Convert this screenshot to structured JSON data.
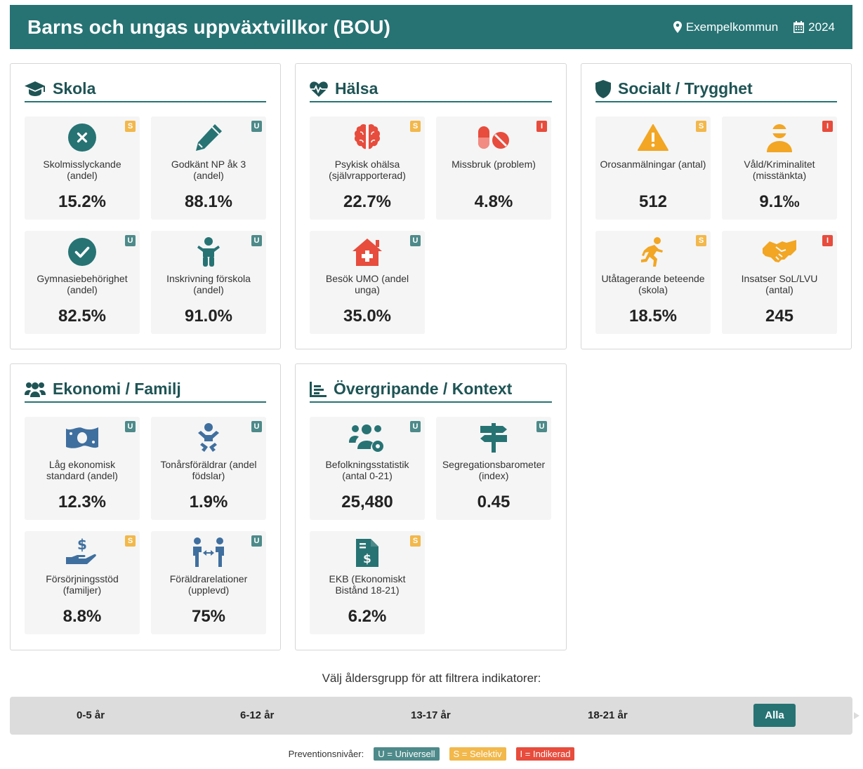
{
  "header": {
    "title": "Barns och ungas uppväxtvillkor (BOU)",
    "location": "Exempelkommun",
    "year": "2024"
  },
  "colors": {
    "primary": "#277374",
    "universell": "#4e8a8a",
    "selektiv": "#f2b84b",
    "indikerad": "#e74c3c",
    "icon_teal": "#277374",
    "icon_red": "#e74c3c",
    "icon_orange": "#f2a623",
    "icon_blue": "#3f6f9f"
  },
  "sections": {
    "skola": {
      "title": "Skola",
      "icon": "graduation-cap-icon",
      "tiles": [
        {
          "label": "Skolmisslyckande (andel)",
          "value": "15.2%",
          "level": "S",
          "icon": "x-circle-icon"
        },
        {
          "label": "Godkänt NP åk 3 (andel)",
          "value": "88.1%",
          "level": "U",
          "icon": "pencil-icon"
        },
        {
          "label": "Gymnasiebehörighet (andel)",
          "value": "82.5%",
          "level": "U",
          "icon": "check-circle-icon"
        },
        {
          "label": "Inskrivning förskola (andel)",
          "value": "91.0%",
          "level": "U",
          "icon": "child-icon"
        }
      ]
    },
    "halsa": {
      "title": "Hälsa",
      "icon": "heartbeat-icon",
      "tiles": [
        {
          "label": "Psykisk ohälsa (självrapporterad)",
          "value": "22.7%",
          "level": "S",
          "icon": "brain-icon"
        },
        {
          "label": "Missbruk (problem)",
          "value": "4.8%",
          "level": "I",
          "icon": "pills-icon"
        },
        {
          "label": "Besök UMO (andel unga)",
          "value": "35.0%",
          "level": "U",
          "icon": "clinic-house-icon"
        }
      ]
    },
    "socialt": {
      "title": "Socialt / Trygghet",
      "icon": "shield-icon",
      "tiles": [
        {
          "label": "Orosanmälningar (antal)",
          "value": "512",
          "level": "S",
          "icon": "warning-icon"
        },
        {
          "label": "Våld/Kriminalitet (misstänkta)",
          "value": "9.1‰",
          "level": "I",
          "icon": "masked-person-icon"
        },
        {
          "label": "Utåtagerande beteende (skola)",
          "value": "18.5%",
          "level": "S",
          "icon": "running-person-icon"
        },
        {
          "label": "Insatser SoL/LVU (antal)",
          "value": "245",
          "level": "I",
          "icon": "handshake-icon"
        }
      ]
    },
    "ekonomi": {
      "title": "Ekonomi / Familj",
      "icon": "users-icon",
      "tiles": [
        {
          "label": "Låg ekonomisk standard (andel)",
          "value": "12.3%",
          "level": "U",
          "icon": "money-bill-icon"
        },
        {
          "label": "Tonårsföräldrar (andel födslar)",
          "value": "1.9%",
          "level": "U",
          "icon": "baby-icon"
        },
        {
          "label": "Försörjningsstöd (familjer)",
          "value": "8.8%",
          "level": "S",
          "icon": "hand-dollar-icon"
        },
        {
          "label": "Föräldrarelationer (upplevd)",
          "value": "75%",
          "level": "U",
          "icon": "people-arrows-icon"
        }
      ]
    },
    "kontext": {
      "title": "Övergripande / Kontext",
      "icon": "chart-area-icon",
      "tiles": [
        {
          "label": "Befolkningsstatistik (antal 0-21)",
          "value": "25,480",
          "level": "U",
          "icon": "users-gear-icon"
        },
        {
          "label": "Segregationsbarometer (index)",
          "value": "0.45",
          "level": "U",
          "icon": "signpost-icon"
        },
        {
          "label": "EKB (Ekonomiskt Bistånd 18-21)",
          "value": "6.2%",
          "level": "S",
          "icon": "file-invoice-dollar-icon"
        }
      ]
    }
  },
  "filter": {
    "label": "Välj åldersgrupp för att filtrera indikatorer:",
    "options": [
      "0-5 år",
      "6-12 år",
      "13-17 år",
      "18-21 år",
      "Alla"
    ],
    "selected": "Alla"
  },
  "legend": {
    "title": "Preventionsnivåer:",
    "items": [
      {
        "text": "U = Universell",
        "level": "U"
      },
      {
        "text": "S = Selektiv",
        "level": "S"
      },
      {
        "text": "I = Indikerad",
        "level": "I"
      }
    ]
  }
}
